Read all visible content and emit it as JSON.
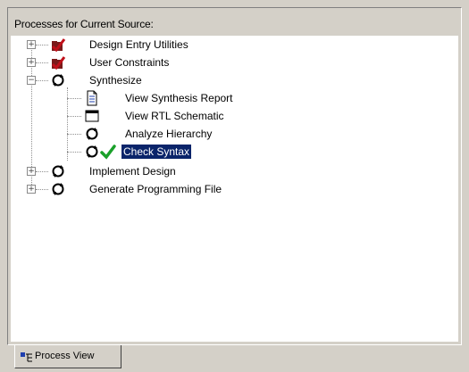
{
  "panel": {
    "title": "Processes for Current Source:"
  },
  "tree": {
    "items": [
      {
        "label": "Design Entry Utilities",
        "icon": "checked-folder-icon",
        "expander": "+"
      },
      {
        "label": "User Constraints",
        "icon": "checked-folder-icon",
        "expander": "+"
      },
      {
        "label": "Synthesize",
        "icon": "process-cycle-icon",
        "expander": "-",
        "children": [
          {
            "label": "View Synthesis Report",
            "icon": "report-document-icon"
          },
          {
            "label": "View RTL Schematic",
            "icon": "schematic-window-icon"
          },
          {
            "label": "Analyze Hierarchy",
            "icon": "process-cycle-icon"
          },
          {
            "label": "Check Syntax",
            "icon": "process-cycle-icon",
            "status_icon": "green-check-icon",
            "selected": true
          }
        ]
      },
      {
        "label": "Implement Design",
        "icon": "process-cycle-icon",
        "expander": "+"
      },
      {
        "label": "Generate Programming File",
        "icon": "process-cycle-icon",
        "expander": "+"
      }
    ]
  },
  "tabs": [
    {
      "label": "Process View",
      "icon": "process-view-icon",
      "active": true
    }
  ],
  "colors": {
    "selection": "#0a246a",
    "check_green": "#1aa02a",
    "check_red": "#c0101a"
  }
}
